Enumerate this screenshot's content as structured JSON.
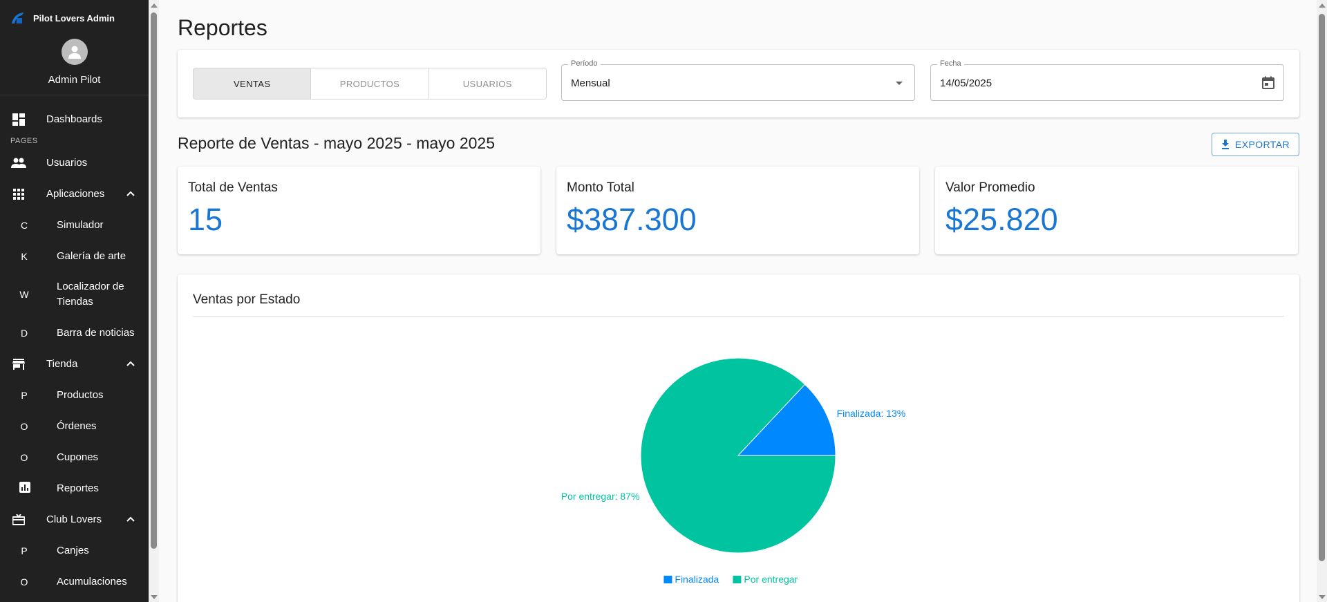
{
  "app": {
    "title": "Pilot Lovers Admin"
  },
  "user": {
    "name": "Admin Pilot"
  },
  "sidebar": {
    "section_label": "PAGES",
    "dashboards": "Dashboards",
    "usuarios": "Usuarios",
    "aplicaciones": {
      "label": "Aplicaciones",
      "items": [
        {
          "letter": "C",
          "label": "Simulador"
        },
        {
          "letter": "K",
          "label": "Galería de arte"
        },
        {
          "letter": "W",
          "label": "Localizador de Tiendas"
        },
        {
          "letter": "D",
          "label": "Barra de noticias"
        }
      ]
    },
    "tienda": {
      "label": "Tienda",
      "items": [
        {
          "letter": "P",
          "label": "Productos"
        },
        {
          "letter": "O",
          "label": "Órdenes"
        },
        {
          "letter": "O",
          "label": "Cupones"
        }
      ],
      "reportes": "Reportes"
    },
    "club": {
      "label": "Club Lovers",
      "items": [
        {
          "letter": "P",
          "label": "Canjes"
        },
        {
          "letter": "O",
          "label": "Acumulaciones"
        }
      ]
    }
  },
  "page": {
    "title": "Reportes"
  },
  "filters": {
    "tabs": [
      "VENTAS",
      "PRODUCTOS",
      "USUARIOS"
    ],
    "active_tab": "VENTAS",
    "periodo": {
      "label": "Período",
      "value": "Mensual"
    },
    "fecha": {
      "label": "Fecha",
      "value": "14/05/2025"
    }
  },
  "report": {
    "title": "Reporte de Ventas - mayo 2025 - mayo 2025",
    "export_label": "EXPORTAR"
  },
  "stats": [
    {
      "label": "Total de Ventas",
      "value": "15"
    },
    {
      "label": "Monto Total",
      "value": "$387.300"
    },
    {
      "label": "Valor Promedio",
      "value": "$25.820"
    }
  ],
  "chart_section": {
    "title": "Ventas por Estado"
  },
  "chart_data": {
    "type": "pie",
    "title": "Ventas por Estado",
    "categories": [
      "Finalizada",
      "Por entregar"
    ],
    "values": [
      13,
      87
    ],
    "slice_labels": [
      "Finalizada: 13%",
      "Por entregar: 87%"
    ],
    "colors": [
      "#0088fe",
      "#00c49f"
    ],
    "legend": "bottom-center"
  },
  "colors": {
    "accent": "#1976d2",
    "sidebar_bg": "#212121"
  }
}
